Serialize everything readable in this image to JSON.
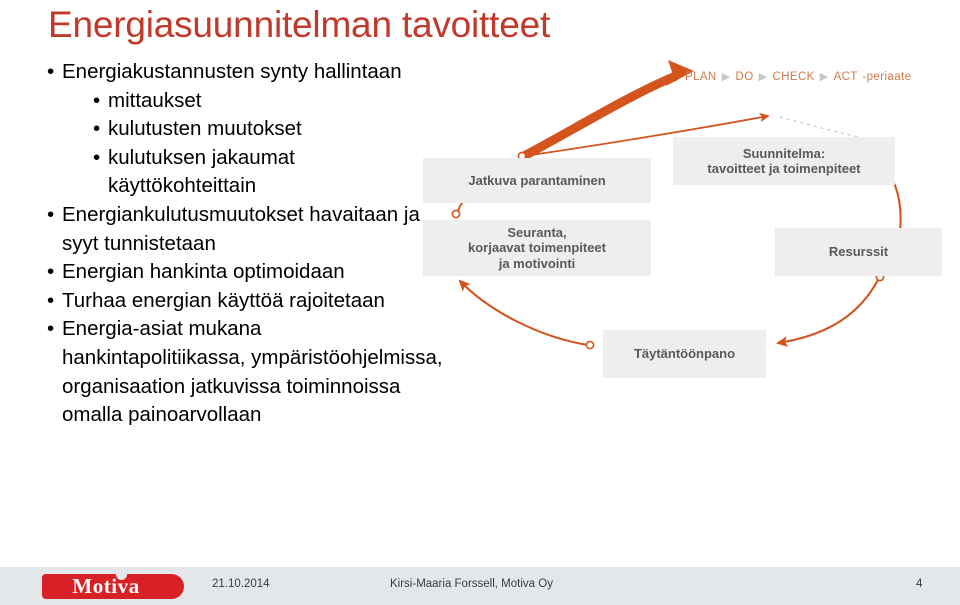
{
  "slide": {
    "title": "Energiasuunnitelman tavoitteet",
    "bullets": [
      {
        "level": 1,
        "text": "Energiakustannusten synty hallintaan"
      },
      {
        "level": 2,
        "text": "mittaukset"
      },
      {
        "level": 2,
        "text": "kulutusten muutokset"
      },
      {
        "level": 2,
        "text": "kulutuksen jakaumat käyttökohteittain"
      },
      {
        "level": 1,
        "text": "Energiankulutusmuutokset havaitaan ja syyt tunnistetaan"
      },
      {
        "level": 1,
        "text": "Energian hankinta optimoidaan"
      },
      {
        "level": 1,
        "text": "Turhaa energian käyttöä rajoitetaan"
      },
      {
        "level": 1,
        "text": "Energia-asiat mukana hankintapolitiikassa, ympäristöohjelmissa, organisaation jatkuvissa toiminnoissa omalla painoarvollaan"
      }
    ],
    "bullet_glyph": "•"
  },
  "diagram": {
    "caption": {
      "words": [
        "PLAN",
        "DO",
        "CHECK",
        "ACT"
      ],
      "separator": "▶",
      "suffix": "-periaate"
    },
    "boxes": {
      "jatkuva": "Jatkuva parantaminen",
      "seuranta": "Seuranta,\nkorjaavat toimenpiteet\nja motivointi",
      "suunnitelma": "Suunnitelma:\ntavoitteet ja toimenpiteet",
      "resurssit": "Resurssit",
      "taytantoonpano": "Täytäntöönpano"
    }
  },
  "footer": {
    "logo_text": "Motiva",
    "date": "21.10.2014",
    "author": "Kirsi-Maaria Forssell, Motiva Oy",
    "page": "4"
  },
  "colors": {
    "title": "#c0392b",
    "accent_orange": "#d4541e",
    "box_fill": "#eeeeee",
    "box_text": "#595959",
    "caption_text": "#d4794a",
    "footer_bar": "#e3e7ea",
    "logo_red": "#d82027"
  }
}
